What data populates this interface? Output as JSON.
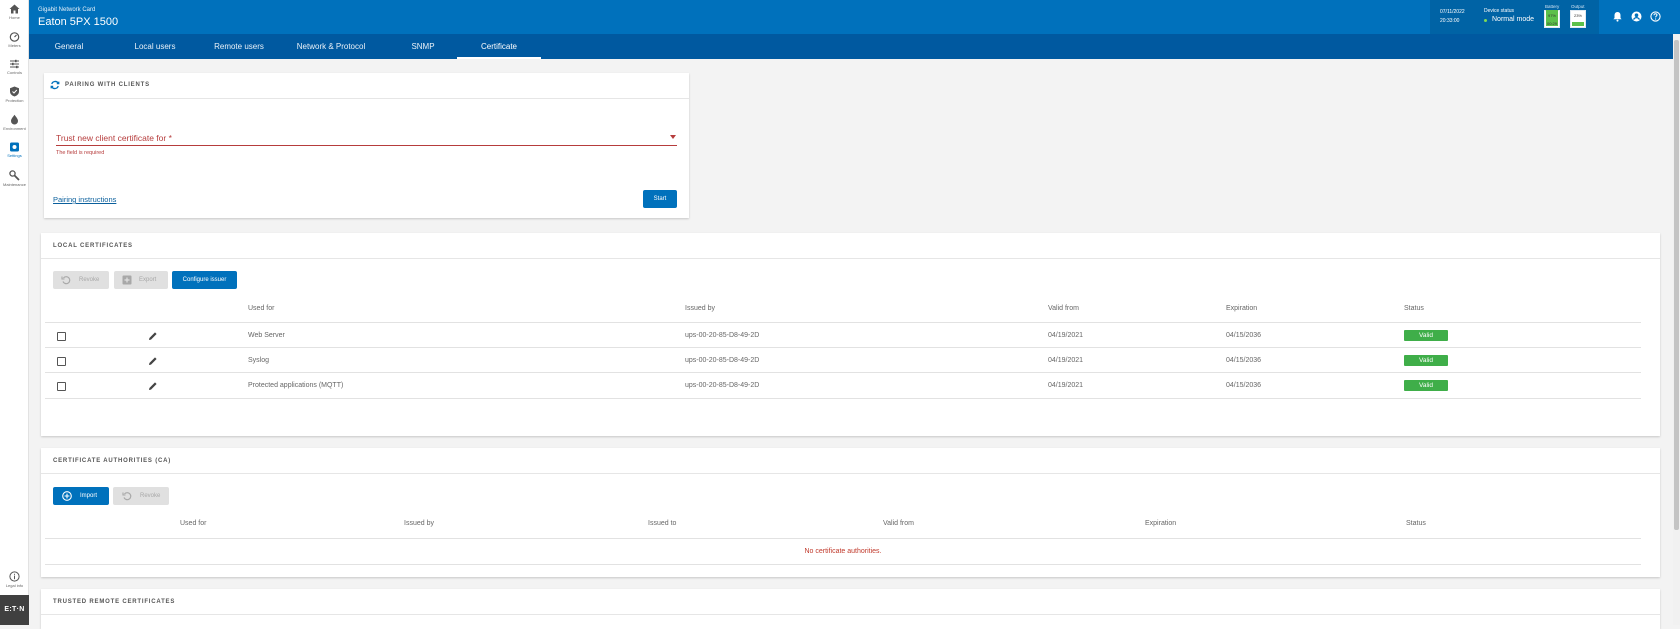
{
  "sidebar": {
    "items": [
      {
        "label": "Home",
        "icon": "home-icon"
      },
      {
        "label": "Meters",
        "icon": "gauge-icon"
      },
      {
        "label": "Controls",
        "icon": "sliders-icon"
      },
      {
        "label": "Protection",
        "icon": "shield-icon"
      },
      {
        "label": "Environment",
        "icon": "drop-icon"
      },
      {
        "label": "Settings",
        "icon": "settings-icon"
      },
      {
        "label": "Maintenance",
        "icon": "wrench-icon"
      }
    ],
    "legal": {
      "label": "Legal info",
      "icon": "info-icon"
    },
    "logo": "E:T·N"
  },
  "header": {
    "subtitle": "Gigabit Network Card",
    "title": "Eaton 5PX 1500",
    "date": "07/11/2022",
    "time": "20:33:00",
    "device_status_label": "Device status",
    "device_status_value": "Normal mode",
    "battery_label": "Battery",
    "battery_percent": "97%",
    "battery_time": "00:29",
    "battery_level": 97,
    "output_label": "Output",
    "output_percent": "23%",
    "output_level": 23,
    "status_color": "#7ed957",
    "accent": "#0071bc"
  },
  "tabs": [
    {
      "label": "General"
    },
    {
      "label": "Local users"
    },
    {
      "label": "Remote users"
    },
    {
      "label": "Network & Protocol"
    },
    {
      "label": "SNMP"
    },
    {
      "label": "Certificate",
      "active": true
    }
  ],
  "pairing": {
    "title": "PAIRING WITH CLIENTS",
    "field_label": "Trust new client certificate for *",
    "field_error": "The field is required",
    "instructions_link": "Pairing instructions",
    "start_button": "Start"
  },
  "local_certs": {
    "title": "LOCAL CERTIFICATES",
    "revoke_button": "Revoke",
    "export_button": "Export",
    "configure_button": "Configure issuer",
    "columns": [
      "Used for",
      "Issued by",
      "Valid from",
      "Expiration",
      "Status"
    ],
    "rows": [
      {
        "used_for": "Web Server",
        "issued_by": "ups-00-20-85-D8-49-2D",
        "valid_from": "04/19/2021",
        "expiration": "04/15/2036",
        "status": "Valid"
      },
      {
        "used_for": "Syslog",
        "issued_by": "ups-00-20-85-D8-49-2D",
        "valid_from": "04/19/2021",
        "expiration": "04/15/2036",
        "status": "Valid"
      },
      {
        "used_for": "Protected applications (MQTT)",
        "issued_by": "ups-00-20-85-D8-49-2D",
        "valid_from": "04/19/2021",
        "expiration": "04/15/2036",
        "status": "Valid"
      }
    ],
    "status_color": "#3fae49"
  },
  "ca": {
    "title": "CERTIFICATE AUTHORITIES (CA)",
    "import_button": "Import",
    "revoke_button": "Revoke",
    "columns": [
      "Used for",
      "Issued by",
      "Issued to",
      "Valid from",
      "Expiration",
      "Status"
    ],
    "empty_message": "No certificate authorities."
  },
  "trusted": {
    "title": "TRUSTED REMOTE CERTIFICATES"
  }
}
